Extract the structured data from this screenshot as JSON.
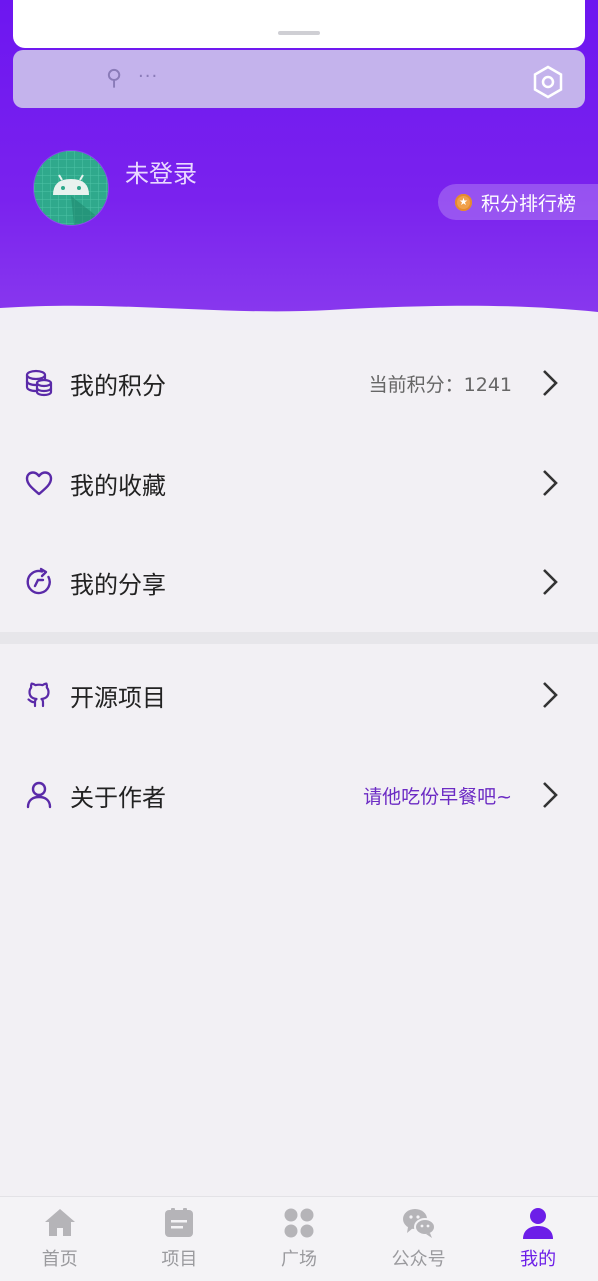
{
  "colors": {
    "primary": "#6d16f0",
    "accent_text": "#6c2bc4",
    "active_tab": "#6c1ee8",
    "inactive_tab": "#b5b4b8",
    "coin": "#f0a04b"
  },
  "profile": {
    "username": "未登录",
    "avatar_icon": "android-icon"
  },
  "rank_button": {
    "label": "积分排行榜",
    "icon": "coin-icon"
  },
  "menu": {
    "points": {
      "label": "我的积分",
      "value": "当前积分：1241",
      "icon": "coins-icon"
    },
    "favorites": {
      "label": "我的收藏",
      "icon": "heart-icon"
    },
    "shares": {
      "label": "我的分享",
      "icon": "share-icon"
    },
    "opensource": {
      "label": "开源项目",
      "icon": "github-icon"
    },
    "about": {
      "label": "关于作者",
      "value": "请他吃份早餐吧~",
      "icon": "person-icon"
    }
  },
  "bottom_nav": {
    "tabs": [
      {
        "label": "首页",
        "icon": "home-icon",
        "active": false
      },
      {
        "label": "项目",
        "icon": "project-icon",
        "active": false
      },
      {
        "label": "广场",
        "icon": "grid-icon",
        "active": false
      },
      {
        "label": "公众号",
        "icon": "wechat-icon",
        "active": false
      },
      {
        "label": "我的",
        "icon": "profile-icon",
        "active": true
      }
    ]
  }
}
